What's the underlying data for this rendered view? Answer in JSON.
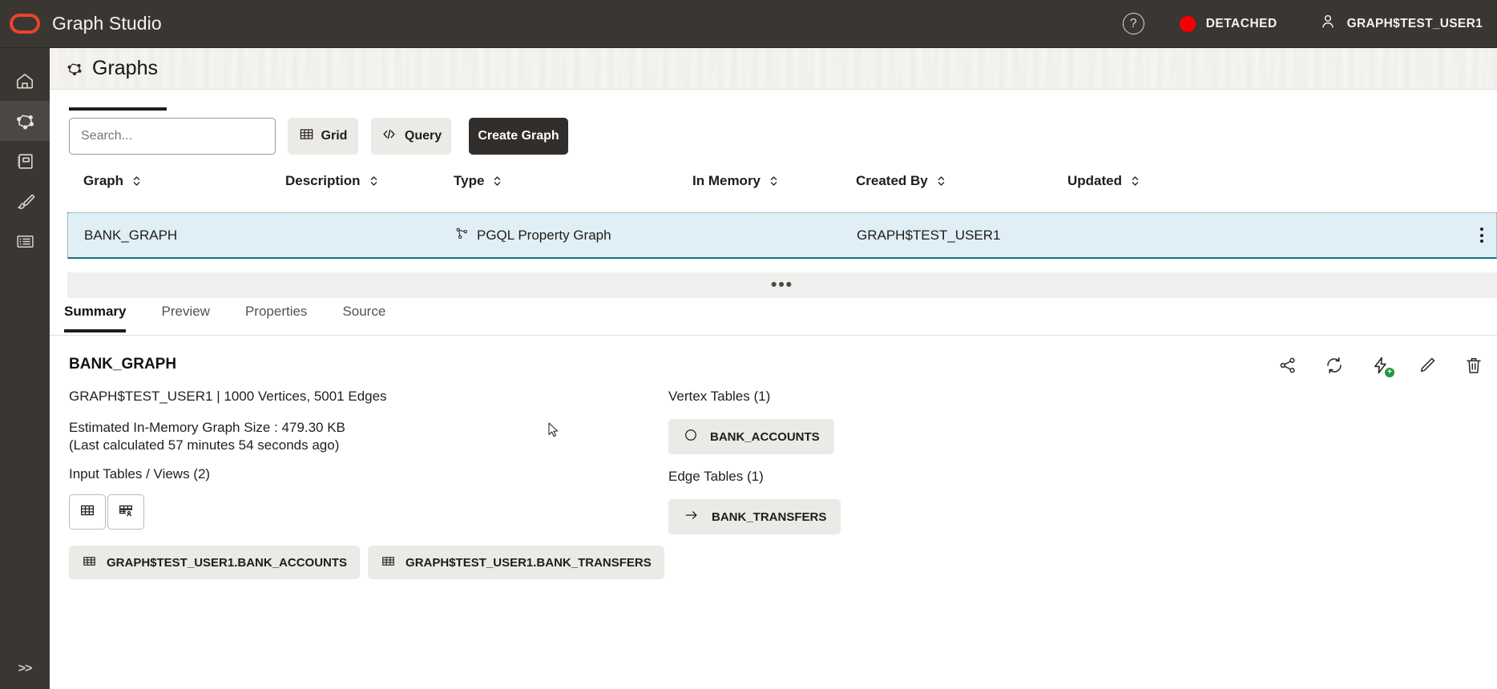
{
  "app": {
    "brand": "Graph Studio",
    "logo_color": "#e8452c",
    "logo_icon": "oracle-ring-logo"
  },
  "topbar": {
    "help_icon": "question-circle-icon",
    "help_glyph": "?",
    "status_dot_color": "#f40000",
    "status_text": "DETACHED",
    "user_icon": "person-icon",
    "user_name": "GRAPH$TEST_USER1"
  },
  "rail": {
    "items": [
      {
        "name": "home",
        "icon": "home-icon",
        "active": false
      },
      {
        "name": "graphs",
        "icon": "graph-node-icon",
        "active": true
      },
      {
        "name": "notebooks",
        "icon": "notebook-icon",
        "active": false
      },
      {
        "name": "designer",
        "icon": "paintbrush-icon",
        "active": false
      },
      {
        "name": "jobs",
        "icon": "table-list-icon",
        "active": false
      }
    ],
    "expand_label": ">>"
  },
  "page": {
    "icon": "graph-node-icon",
    "title": "Graphs"
  },
  "toolbar": {
    "search_value": "",
    "search_placeholder": "Search...",
    "grid_label": "Grid",
    "grid_icon": "table-grid-icon",
    "query_label": "Query",
    "query_icon": "code-brackets-icon",
    "create_label": "Create Graph"
  },
  "table": {
    "columns": [
      {
        "label": "Graph",
        "sortable": true
      },
      {
        "label": "Description",
        "sortable": true
      },
      {
        "label": "Type",
        "sortable": true
      },
      {
        "label": "In Memory",
        "sortable": true
      },
      {
        "label": "Created By",
        "sortable": true
      },
      {
        "label": "Updated",
        "sortable": true
      }
    ],
    "rows": [
      {
        "graph": "BANK_GRAPH",
        "description": "",
        "type": "PGQL Property Graph",
        "type_icon": "pgql-graph-icon",
        "in_memory": "",
        "created_by": "GRAPH$TEST_USER1",
        "updated": "",
        "selected": true,
        "menu_icon": "kebab-menu-icon"
      }
    ],
    "selected_row_bg": "#e0eff5",
    "selected_row_accent": "#17707f"
  },
  "splitter": {
    "handle": "•••"
  },
  "detail": {
    "tabs": [
      {
        "label": "Summary",
        "active": true
      },
      {
        "label": "Preview",
        "active": false
      },
      {
        "label": "Properties",
        "active": false
      },
      {
        "label": "Source",
        "active": false
      }
    ],
    "summary": {
      "title": "BANK_GRAPH",
      "meta": "GRAPH$TEST_USER1 | 1000 Vertices, 5001 Edges",
      "size_line1": "Estimated In-Memory Graph Size : 479.30 KB",
      "size_line2": "(Last calculated 57 minutes 54 seconds ago)",
      "inputs_label": "Input Tables / Views (2)",
      "view_toggles": [
        {
          "name": "table-view-toggle",
          "icon": "table-grid-icon"
        },
        {
          "name": "table-user-view-toggle",
          "icon": "table-person-icon"
        }
      ],
      "input_chips": [
        {
          "label": "GRAPH$TEST_USER1.BANK_ACCOUNTS",
          "icon": "table-grid-icon"
        },
        {
          "label": "GRAPH$TEST_USER1.BANK_TRANSFERS",
          "icon": "table-grid-icon"
        }
      ],
      "vertex_label": "Vertex Tables (1)",
      "vertex_chip": {
        "label": "BANK_ACCOUNTS",
        "icon": "circle-vertex-icon"
      },
      "edge_label": "Edge Tables (1)",
      "edge_chip": {
        "label": "BANK_TRANSFERS",
        "icon": "arrow-edge-icon"
      },
      "actions": [
        {
          "name": "share-graph-icon"
        },
        {
          "name": "refresh-graph-icon"
        },
        {
          "name": "load-into-memory-icon",
          "badge": "+",
          "badge_color": "#1d9a3c"
        },
        {
          "name": "edit-graph-icon"
        },
        {
          "name": "delete-graph-icon"
        }
      ]
    }
  }
}
